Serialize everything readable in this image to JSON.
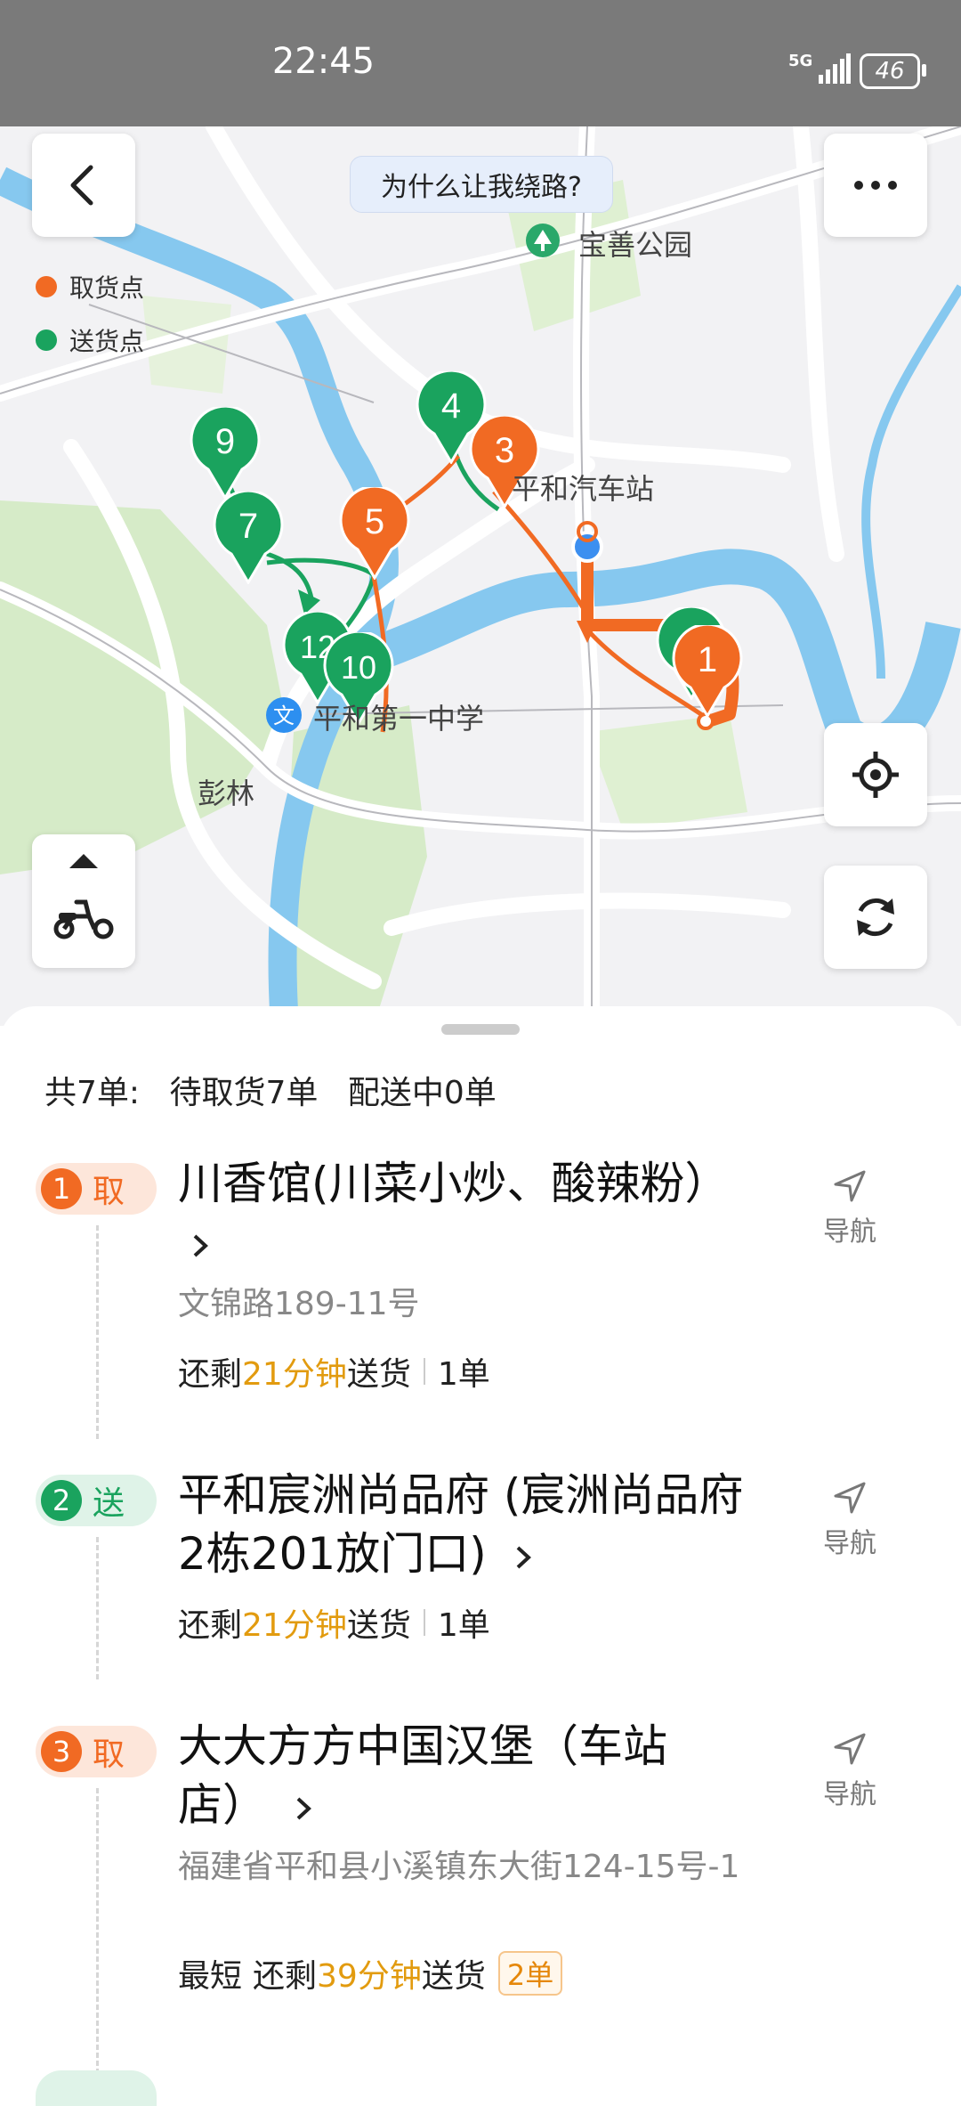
{
  "status_bar": {
    "time": "22:45",
    "network": "5G",
    "battery": "46"
  },
  "map": {
    "detour_question": "为什么让我绕路?",
    "legend": [
      {
        "label": "取货点",
        "color": "#f16a23"
      },
      {
        "label": "送货点",
        "color": "#1aa35e"
      }
    ],
    "places": {
      "park": "宝善公园",
      "station": "平和汽车站",
      "school": "平和第一中学",
      "area": "彭林"
    },
    "markers": {
      "m9": "9",
      "m4": "4",
      "m3": "3",
      "m7": "7",
      "m5": "5",
      "m12": "12",
      "m10": "10",
      "m1": "1"
    },
    "colors": {
      "pickup": "#f16a23",
      "delivery": "#1aa35e",
      "water": "#86c8ef",
      "green": "#d6ebc8"
    }
  },
  "summary": {
    "total": "共7单:",
    "pending_pickup": "待取货7单",
    "delivering": "配送中0单"
  },
  "tasks": [
    {
      "num": "1",
      "kind": "取",
      "name": "川香馆(川菜小炒、酸辣粉）",
      "address": "文锦路189-11号",
      "prefix": "",
      "remain_pre": "还剩",
      "remain_time": "21分钟",
      "remain_post": "送货",
      "count": "1单",
      "nav": "导航"
    },
    {
      "num": "2",
      "kind": "送",
      "name": "平和宸洲尚品府 (宸洲尚品府2栋201放门口)",
      "remain_pre": "还剩",
      "remain_time": "21分钟",
      "remain_post": "送货",
      "count": "1单",
      "nav": "导航"
    },
    {
      "num": "3",
      "kind": "取",
      "name": "大大方方中国汉堡（车站店）",
      "address": "福建省平和县小溪镇东大街124-15号-1",
      "prefix": "最短",
      "remain_pre": "还剩",
      "remain_time": "39分钟",
      "remain_post": "送货",
      "count": "2单",
      "nav": "导航"
    }
  ]
}
